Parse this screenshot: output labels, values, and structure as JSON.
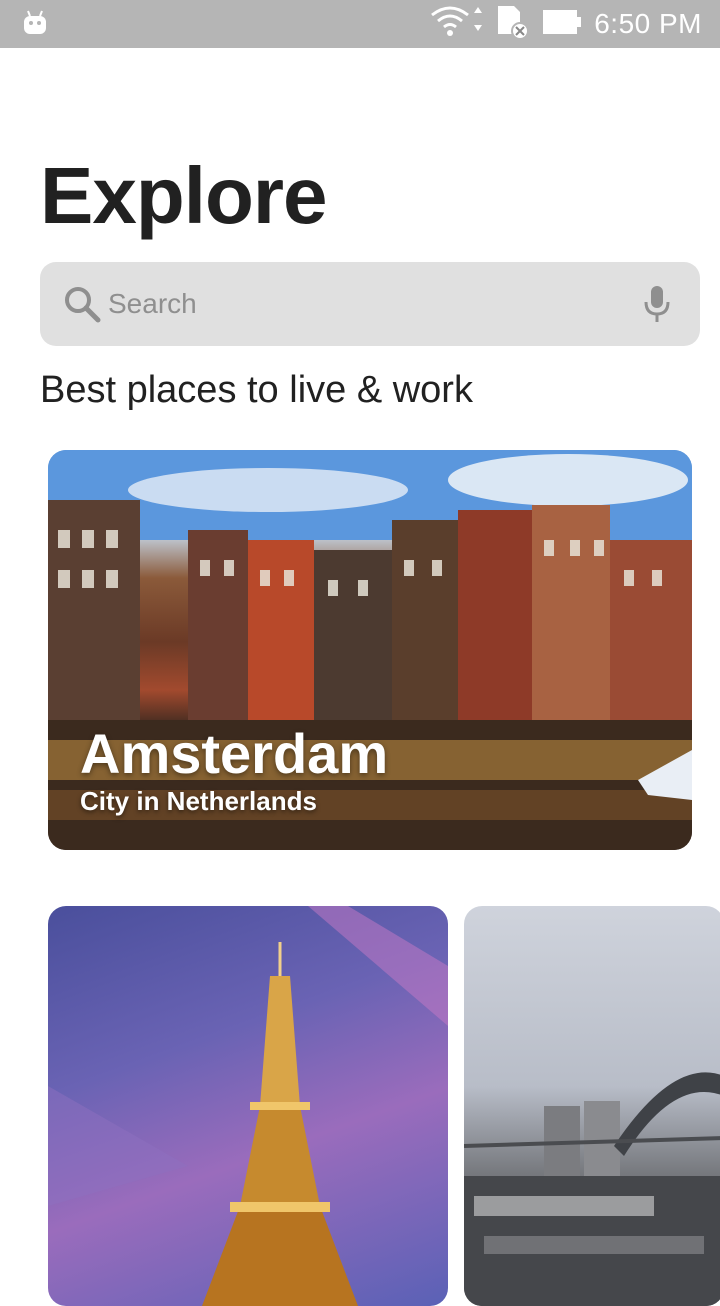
{
  "status_bar": {
    "time": "6:50 PM",
    "icons": [
      "android-icon",
      "wifi-icon",
      "sd-card-icon",
      "battery-icon"
    ]
  },
  "header": {
    "title": "Explore"
  },
  "search": {
    "placeholder": "Search"
  },
  "section": {
    "title": "Best places to live & work"
  },
  "featured": {
    "title": "Amsterdam",
    "subtitle": "City in Netherlands"
  },
  "cards": [
    {
      "name": "paris-card"
    },
    {
      "name": "sydney-card"
    }
  ],
  "colors": {
    "status_bar": "#b5b5b5",
    "search_bg": "#e0e0e0",
    "text_primary": "#212121",
    "placeholder": "#8f8f8f"
  }
}
